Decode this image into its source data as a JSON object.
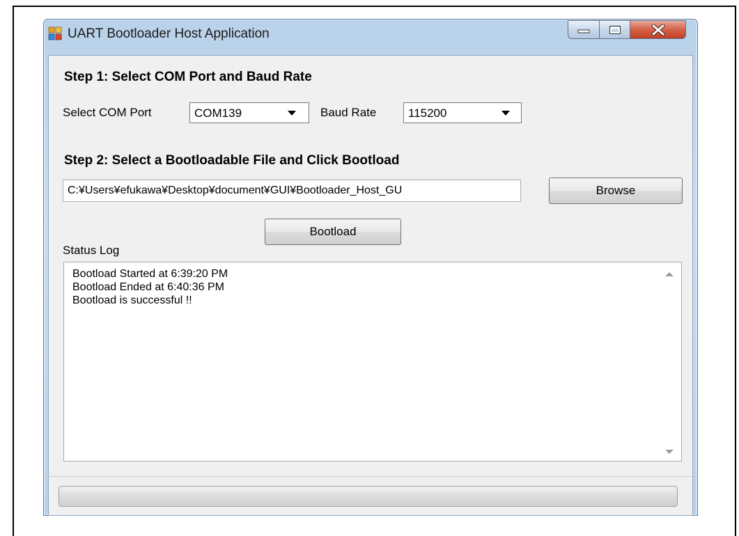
{
  "window": {
    "title": "UART Bootloader Host Application",
    "minimize_icon": "minimize-icon",
    "maximize_icon": "maximize-icon",
    "close_icon": "close-icon",
    "close_color": "#c94a31",
    "app_icon": "app-icon"
  },
  "step1": {
    "heading": "Step 1: Select COM Port and Baud Rate",
    "com_label": "Select COM Port",
    "com_value": "COM139",
    "baud_label": "Baud Rate",
    "baud_value": "115200"
  },
  "step2": {
    "heading": "Step 2: Select a Bootloadable File and Click Bootload",
    "file_path": "C:¥Users¥efukawa¥Desktop¥document¥GUI¥Bootloader_Host_GU",
    "browse_label": "Browse",
    "bootload_label": "Bootload"
  },
  "status": {
    "label": "Status Log",
    "lines": [
      "Bootload Started at 6:39:20 PM",
      "Bootload Ended at 6:40:36 PM",
      "Bootload is successful  !!"
    ]
  },
  "progress": {
    "value": 0
  }
}
